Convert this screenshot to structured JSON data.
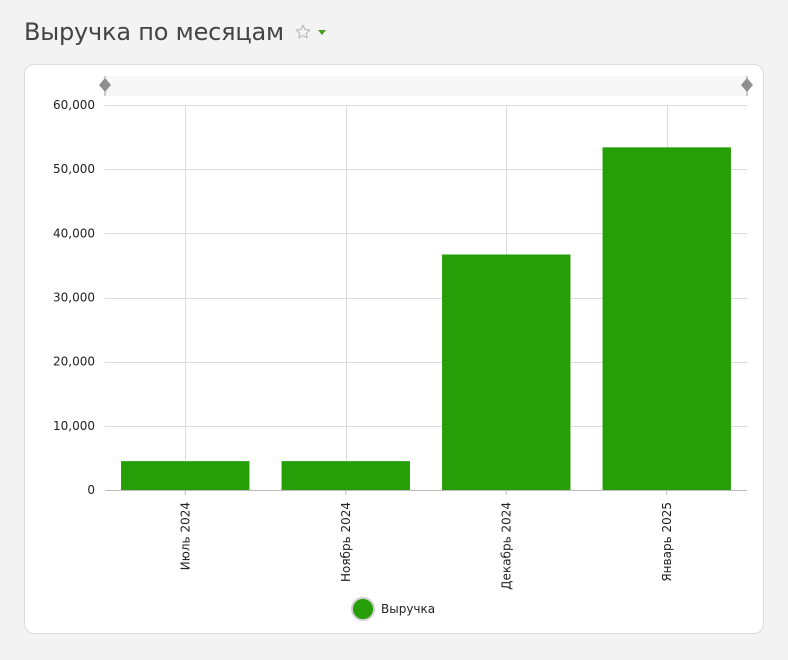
{
  "page": {
    "title": "Выручка по месяцам"
  },
  "icons": {
    "favorite": "star-outline-icon",
    "menu": "caret-down-icon",
    "slider_handle": "diamond-handle-icon"
  },
  "colors": {
    "bar": "#259e07",
    "accent": "#45a017"
  },
  "chart_data": {
    "type": "bar",
    "categories": [
      "Июль 2024",
      "Ноябрь 2024",
      "Декабрь 2024",
      "Январь 2025"
    ],
    "series": [
      {
        "name": "Выручка",
        "values": [
          4500,
          4500,
          36700,
          53400
        ]
      }
    ],
    "ylim": [
      0,
      60000
    ],
    "yticks": [
      0,
      10000,
      20000,
      30000,
      40000,
      50000,
      60000
    ],
    "ytick_labels": [
      "0",
      "10,000",
      "20,000",
      "30,000",
      "40,000",
      "50,000",
      "60,000"
    ],
    "xlabel": "",
    "ylabel": "",
    "grid": true,
    "legend_position": "bottom-center",
    "range_slider": true
  }
}
